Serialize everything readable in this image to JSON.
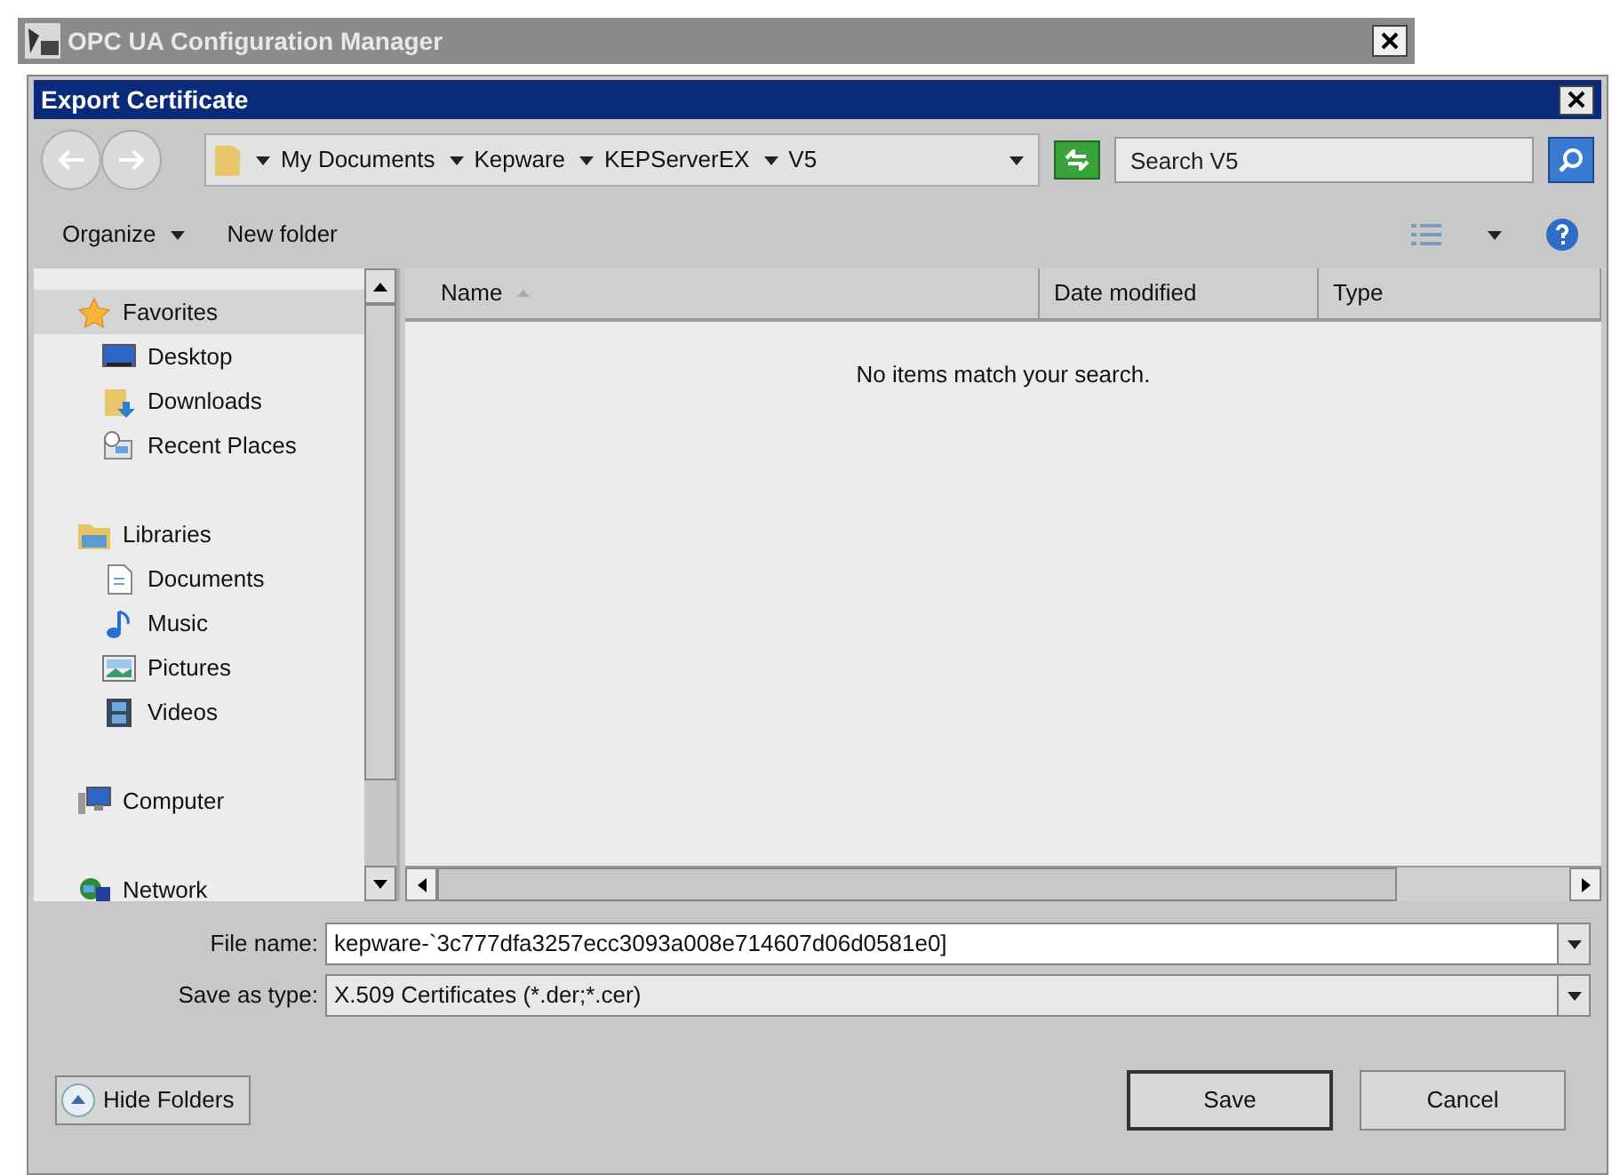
{
  "outer_window": {
    "title": "OPC UA Configuration Manager"
  },
  "dialog": {
    "title": "Export Certificate"
  },
  "address_bar": {
    "breadcrumbs": [
      "My Documents",
      "Kepware",
      "KEPServerEX",
      "V5"
    ]
  },
  "search": {
    "placeholder": "Search V5"
  },
  "toolbar": {
    "buttons": [
      {
        "label": "Organize",
        "kind": "menu"
      },
      {
        "label": "New folder",
        "kind": "plain"
      }
    ]
  },
  "navigation": [
    {
      "label": "Favorites",
      "kind": "star",
      "selected": true,
      "children": [
        {
          "label": "Desktop",
          "kind": "desktop",
          "selected": false
        },
        {
          "label": "Downloads",
          "kind": "downloads",
          "selected": false
        },
        {
          "label": "Recent Places",
          "kind": "recent",
          "selected": false
        }
      ]
    },
    {
      "label": "Libraries",
      "kind": "libraries",
      "selected": false,
      "children": [
        {
          "label": "Documents",
          "kind": "documents",
          "selected": false
        },
        {
          "label": "Music",
          "kind": "music",
          "selected": false
        },
        {
          "label": "Pictures",
          "kind": "pictures",
          "selected": false
        },
        {
          "label": "Videos",
          "kind": "videos",
          "selected": false
        }
      ]
    },
    {
      "label": "Computer",
      "kind": "computer",
      "selected": false
    },
    {
      "label": "Network",
      "kind": "network",
      "selected": false
    }
  ],
  "file_list": {
    "columns": [
      {
        "label": "Name",
        "sorted": true
      },
      {
        "label": "Date modified",
        "sorted": false
      },
      {
        "label": "Type",
        "sorted": false
      }
    ],
    "empty_message": "No items match your search."
  },
  "fields": [
    {
      "label": "File name:",
      "kind": "input",
      "value": "kepware-`3c777dfa3257ecc3093a008e714607d06d0581e0]"
    },
    {
      "label": "Save as type:",
      "kind": "select",
      "value": "X.509 Certificates (*.der;*.cer)"
    }
  ],
  "hide_folders": "Hide Folders",
  "buttons": [
    {
      "label": "Save",
      "default": true
    },
    {
      "label": "Cancel",
      "default": false
    }
  ]
}
